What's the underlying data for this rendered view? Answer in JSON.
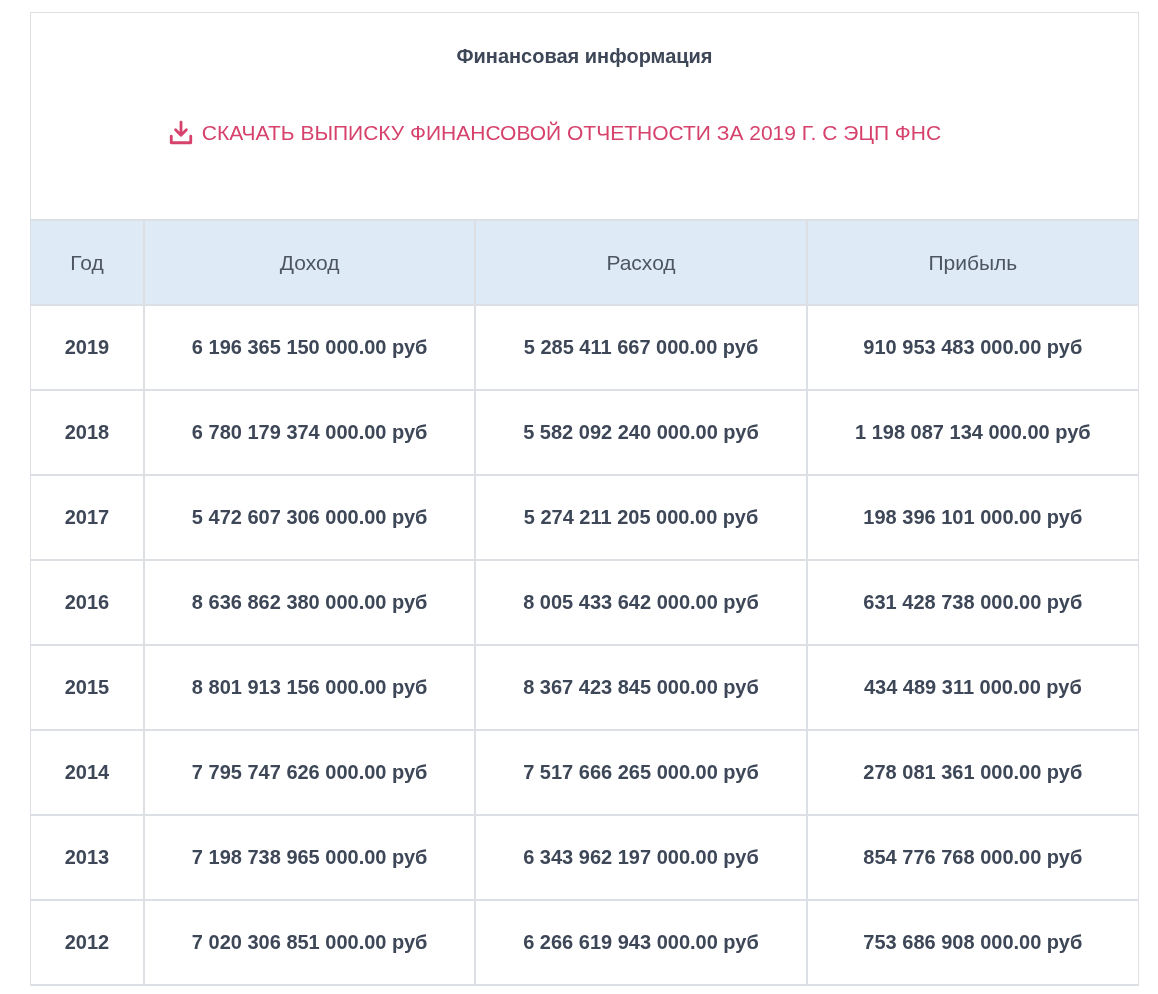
{
  "title": "Финансовая информация",
  "download_link": "СКАЧАТЬ ВЫПИСКУ ФИНАНСОВОЙ ОТЧЕТНОСТИ ЗА 2019 Г. С ЭЦП ФНС",
  "table": {
    "columns": [
      "Год",
      "Доход",
      "Расход",
      "Прибыль"
    ],
    "rows": [
      [
        "2019",
        "6 196 365 150 000.00 руб",
        "5 285 411 667 000.00 руб",
        "910 953 483 000.00 руб"
      ],
      [
        "2018",
        "6 780 179 374 000.00 руб",
        "5 582 092 240 000.00 руб",
        "1 198 087 134 000.00 руб"
      ],
      [
        "2017",
        "5 472 607 306 000.00 руб",
        "5 274 211 205 000.00 руб",
        "198 396 101 000.00 руб"
      ],
      [
        "2016",
        "8 636 862 380 000.00 руб",
        "8 005 433 642 000.00 руб",
        "631 428 738 000.00 руб"
      ],
      [
        "2015",
        "8 801 913 156 000.00 руб",
        "8 367 423 845 000.00 руб",
        "434 489 311 000.00 руб"
      ],
      [
        "2014",
        "7 795 747 626 000.00 руб",
        "7 517 666 265 000.00 руб",
        "278 081 361 000.00 руб"
      ],
      [
        "2013",
        "7 198 738 965 000.00 руб",
        "6 343 962 197 000.00 руб",
        "854 776 768 000.00 руб"
      ],
      [
        "2012",
        "7 020 306 851 000.00 руб",
        "6 266 619 943 000.00 руб",
        "753 686 908 000.00 руб"
      ]
    ]
  }
}
